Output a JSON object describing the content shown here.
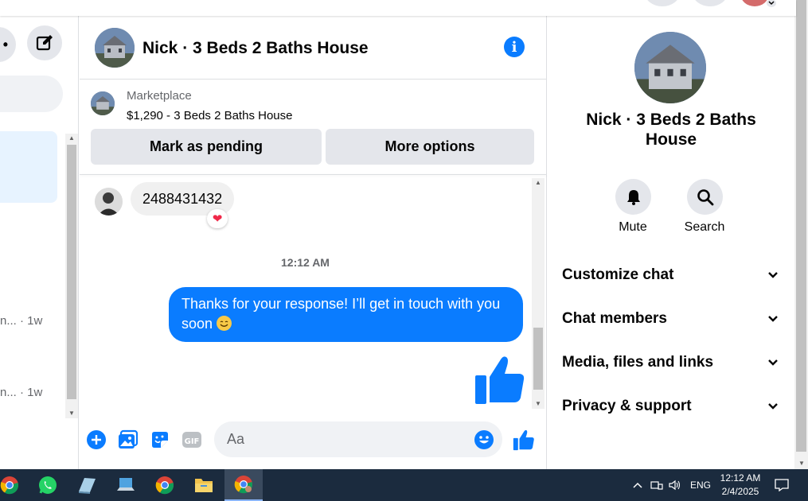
{
  "conversation": {
    "title": "Nick · 3 Beds 2 Baths House"
  },
  "marketplace": {
    "label": "Marketplace",
    "listing": "$1,290 - 3 Beds 2 Baths House",
    "pending_button": "Mark as pending",
    "more_button": "More options"
  },
  "messages": {
    "incoming_text": "2488431432",
    "reaction": "❤",
    "timestamp": "12:12 AM",
    "outgoing_text": "Thanks for your response! I’ll get in touch with you soon"
  },
  "left_list": {
    "meta_1": "n... · 1w",
    "meta_2": "n... · 1w"
  },
  "composer": {
    "placeholder": "Aa"
  },
  "details": {
    "title": "Nick · 3 Beds 2 Baths House",
    "mute_label": "Mute",
    "search_label": "Search",
    "sections": [
      "Customize chat",
      "Chat members",
      "Media, files and links",
      "Privacy & support"
    ]
  },
  "taskbar": {
    "language": "ENG",
    "time": "12:12 AM",
    "date": "2/4/2025"
  },
  "colors": {
    "accent": "#0a7cff",
    "bubble_in": "#f0f0f0",
    "taskbar": "#1b2b3e"
  }
}
